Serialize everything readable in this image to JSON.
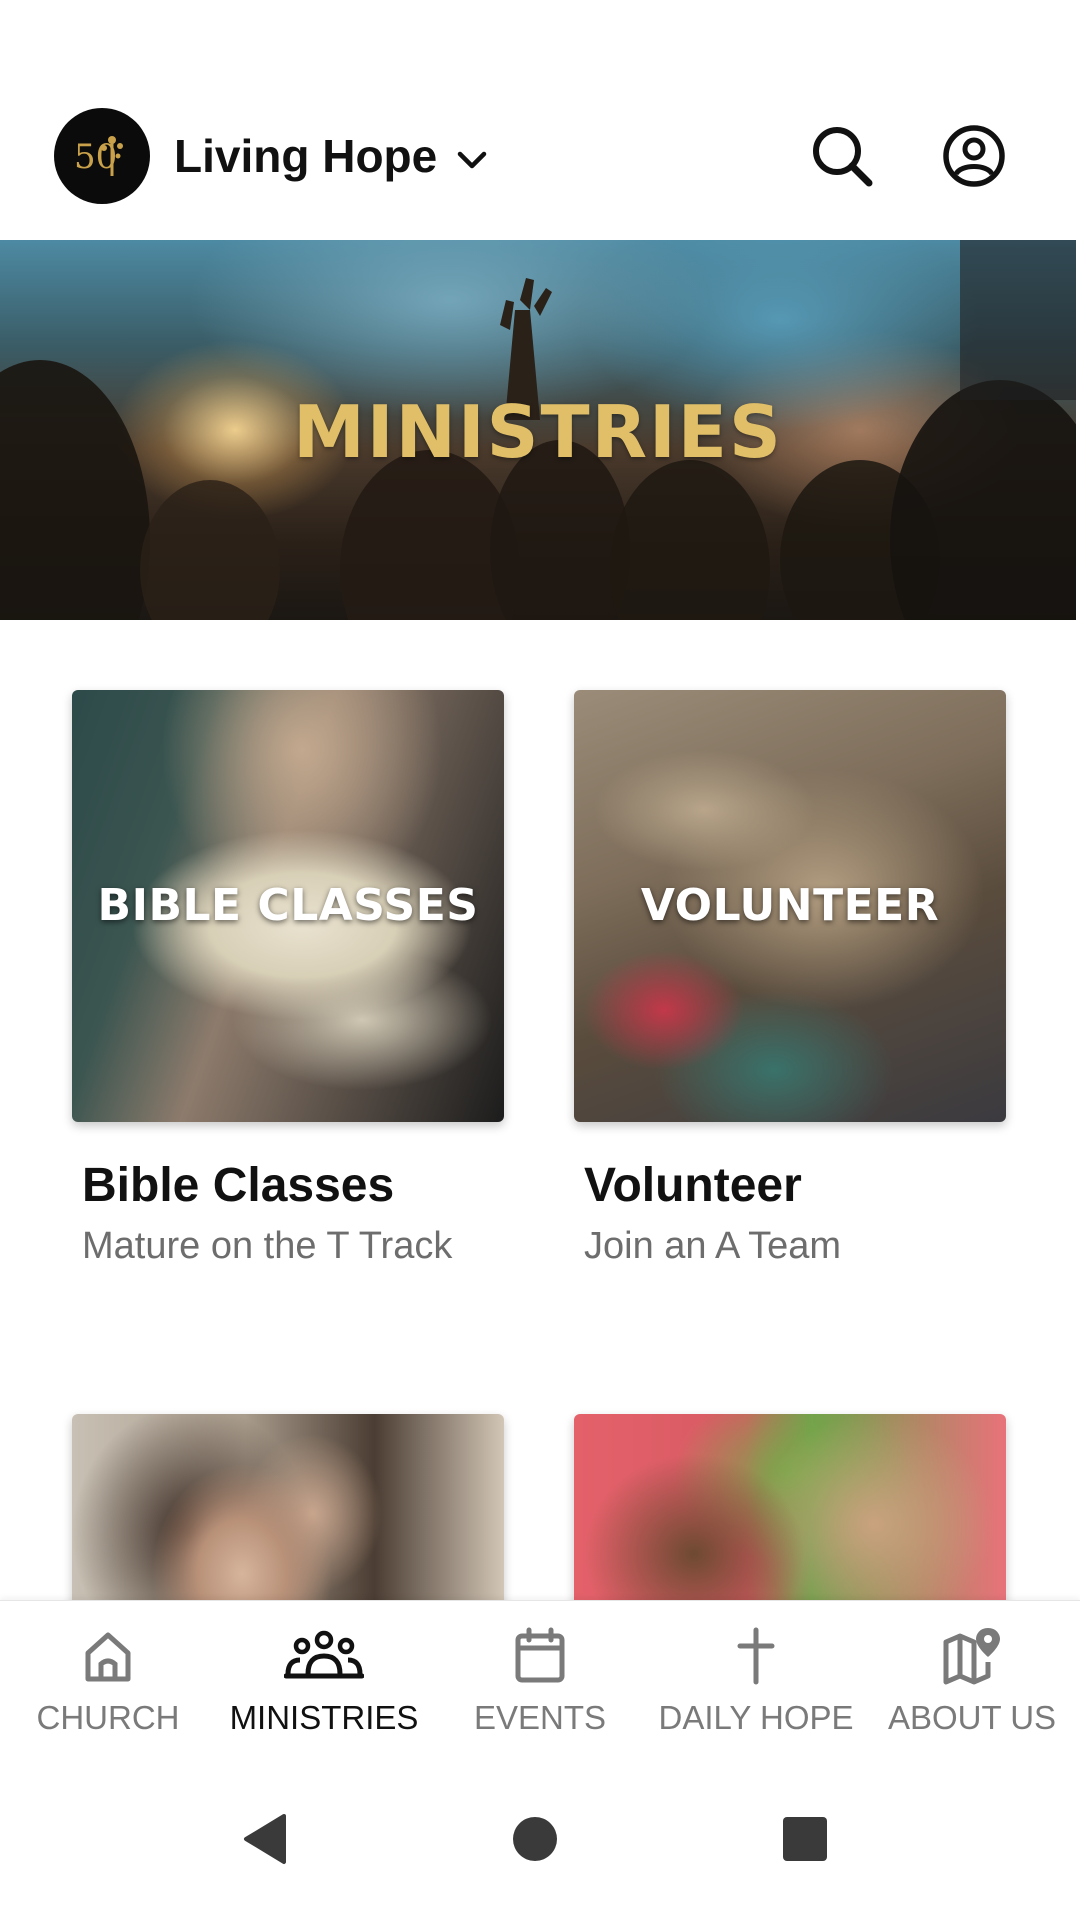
{
  "header": {
    "church_name": "Living Hope",
    "logo_text": "50",
    "logo_icon": "tree-logo-icon",
    "dropdown_icon": "chevron-down-icon",
    "search_icon": "search-icon",
    "account_icon": "account-circle-icon"
  },
  "hero": {
    "title": "MINISTRIES",
    "title_color": "#e0bf68"
  },
  "cards": [
    {
      "overlay_text": "BIBLE CLASSES",
      "title": "Bible Classes",
      "subtitle": "Mature on the T Track"
    },
    {
      "overlay_text": "VOLUNTEER",
      "title": "Volunteer",
      "subtitle": "Join an A Team"
    },
    {
      "overlay_text": "",
      "title": "",
      "subtitle": ""
    },
    {
      "overlay_text": "",
      "title": "",
      "subtitle": ""
    }
  ],
  "bottom_nav": {
    "items": [
      {
        "label": "CHURCH",
        "icon": "home-icon",
        "active": false
      },
      {
        "label": "MINISTRIES",
        "icon": "groups-icon",
        "active": true
      },
      {
        "label": "EVENTS",
        "icon": "calendar-icon",
        "active": false
      },
      {
        "label": "DAILY HOPE",
        "icon": "cross-icon",
        "active": false
      },
      {
        "label": "ABOUT US",
        "icon": "map-pin-icon",
        "active": false
      }
    ],
    "active_color": "#111111",
    "inactive_color": "#7a7a7a"
  },
  "system_nav": {
    "back_icon": "back-triangle-icon",
    "home_icon": "home-circle-icon",
    "recents_icon": "recents-square-icon"
  }
}
